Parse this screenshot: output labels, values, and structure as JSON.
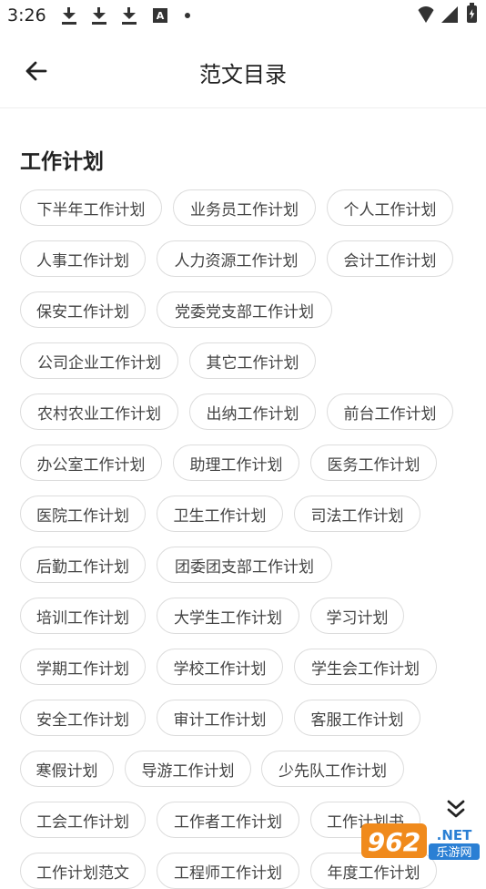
{
  "status_bar": {
    "time": "3:26",
    "left_icons": [
      "download-icon",
      "download-icon",
      "download-icon",
      "a-square-icon",
      "dot-icon"
    ],
    "right_icons": [
      "wifi-icon",
      "signal-icon",
      "battery-charging-icon"
    ]
  },
  "header": {
    "title": "范文目录",
    "back_icon": "arrow-left-icon"
  },
  "section": {
    "title": "工作计划"
  },
  "tags": [
    "下半年工作计划",
    "业务员工作计划",
    "个人工作计划",
    "人事工作计划",
    "人力资源工作计划",
    "会计工作计划",
    "保安工作计划",
    "党委党支部工作计划",
    "公司企业工作计划",
    "其它工作计划",
    "农村农业工作计划",
    "出纳工作计划",
    "前台工作计划",
    "办公室工作计划",
    "助理工作计划",
    "医务工作计划",
    "医院工作计划",
    "卫生工作计划",
    "司法工作计划",
    "后勤工作计划",
    "团委团支部工作计划",
    "培训工作计划",
    "大学生工作计划",
    "学习计划",
    "学期工作计划",
    "学校工作计划",
    "学生会工作计划",
    "安全工作计划",
    "审计工作计划",
    "客服工作计划",
    "寒假计划",
    "导游工作计划",
    "少先队工作计划",
    "工会工作计划",
    "工作者工作计划",
    "工作计划书",
    "工作计划范文",
    "工程师工作计划",
    "年度工作计划"
  ],
  "expand_icon": "double-chevron-down-icon",
  "watermark": {
    "text_number": "962",
    "text_net": ".NET",
    "text_cn": "乐游网",
    "colors": {
      "orange": "#f08a1c",
      "blue": "#2a7fd4"
    }
  }
}
